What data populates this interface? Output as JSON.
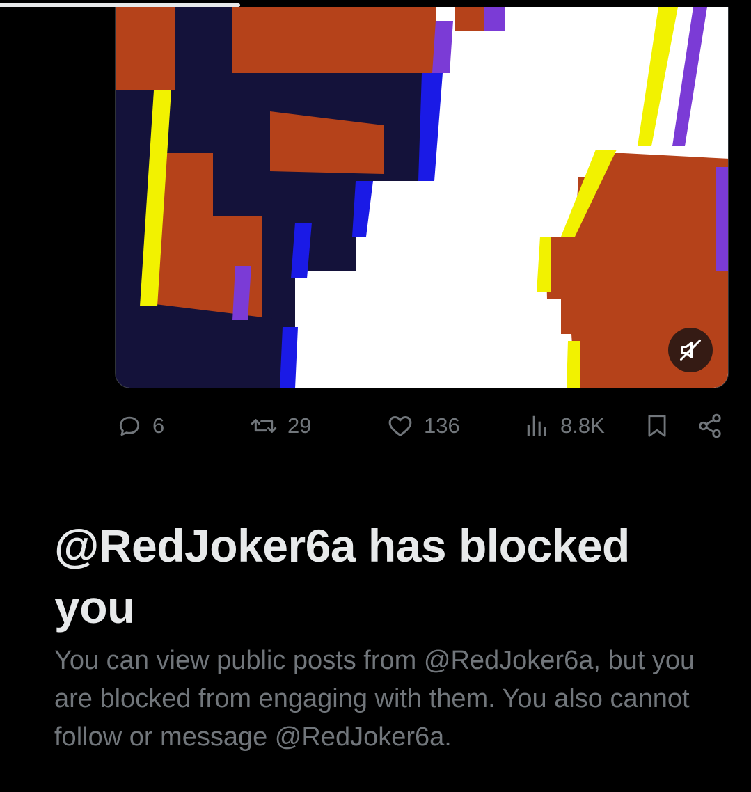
{
  "video": {
    "progress_fraction": 0.32,
    "mute_icon": "speaker-muted-icon",
    "colors": {
      "orange": "#b5421a",
      "navy": "#14123a",
      "yellow": "#f2f200",
      "blue": "#1a1ae6",
      "purple": "#7b3bd6",
      "white": "#ffffff"
    }
  },
  "actions": {
    "reply": {
      "icon": "reply-icon",
      "count": "6"
    },
    "repost": {
      "icon": "repost-icon",
      "count": "29"
    },
    "like": {
      "icon": "heart-icon",
      "count": "136"
    },
    "views": {
      "icon": "views-icon",
      "count": "8.8K"
    },
    "bookmark": {
      "icon": "bookmark-icon"
    },
    "share": {
      "icon": "share-icon"
    },
    "color": "#71767b"
  },
  "blocked_notice": {
    "title": "@RedJoker6a has blocked you",
    "body": "You can view public posts from @RedJoker6a, but you are blocked from engaging with them. You also cannot follow or message @RedJoker6a."
  }
}
